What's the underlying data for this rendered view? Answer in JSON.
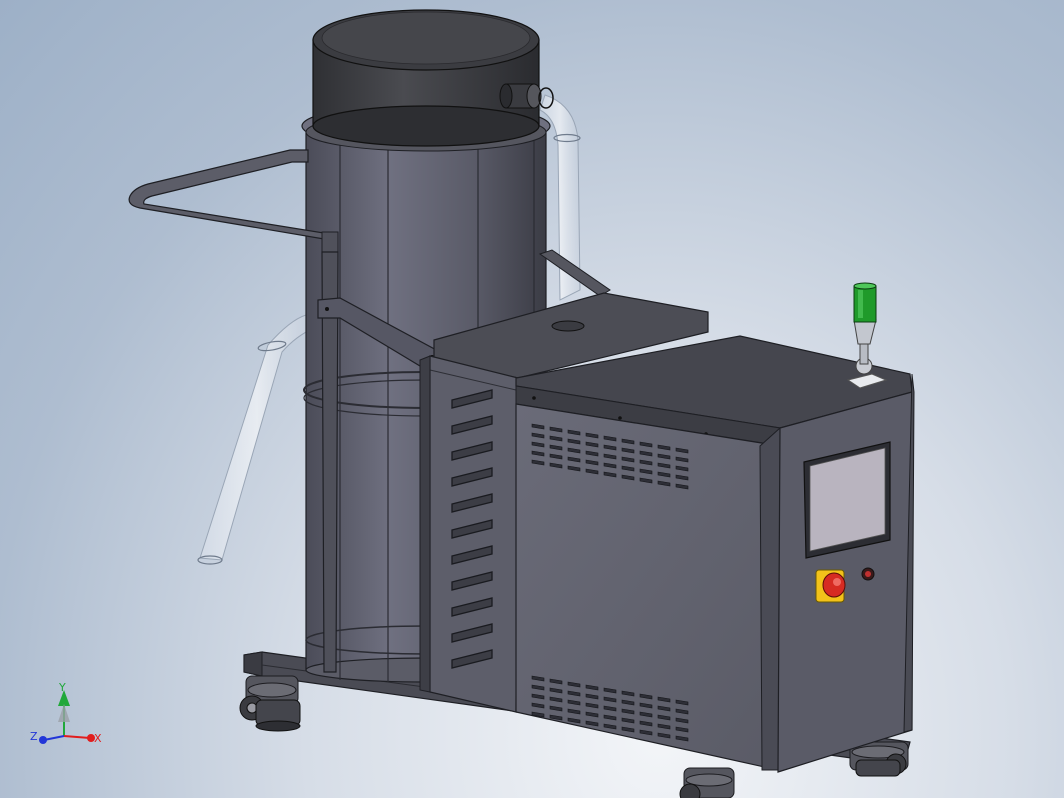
{
  "viewport": {
    "background_center": "#f3f5f8",
    "background_edge": "#9db0c7"
  },
  "model": {
    "body_color": "#5e5f6c",
    "body_dark": "#3f4048",
    "screen_color": "#b9b4bf",
    "beacon_color": "#1f9a2a",
    "estop_cap_color": "#d62b22",
    "estop_base_color": "#f2c21a"
  },
  "triad": {
    "x_label": "X",
    "y_label": "Y",
    "z_label": "Z",
    "x_color": "#e11d1d",
    "y_color": "#20a83a",
    "z_color": "#2236d8"
  }
}
